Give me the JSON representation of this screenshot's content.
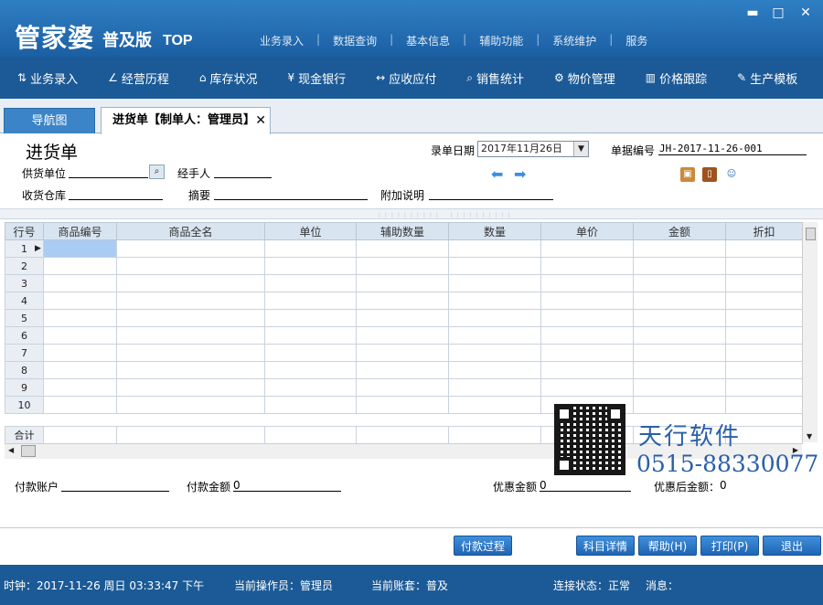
{
  "app": {
    "logo_main": "管家婆",
    "logo_edition": "普及版",
    "logo_top": "TOP"
  },
  "top_nav": [
    "业务录入",
    "数据查询",
    "基本信息",
    "辅助功能",
    "系统维护",
    "服务"
  ],
  "window_controls": {
    "minimize": "▬",
    "maximize": "□",
    "close": "✕"
  },
  "toolbar": [
    {
      "icon": "⇅",
      "label": "业务录入"
    },
    {
      "icon": "∠",
      "label": "经营历程"
    },
    {
      "icon": "⌂",
      "label": "库存状况"
    },
    {
      "icon": "¥",
      "label": "现金银行"
    },
    {
      "icon": "↔",
      "label": "应收应付"
    },
    {
      "icon": "⌕",
      "label": "销售统计"
    },
    {
      "icon": "⚙",
      "label": "物价管理"
    },
    {
      "icon": "▥",
      "label": "价格跟踪"
    },
    {
      "icon": "✎",
      "label": "生产模板"
    }
  ],
  "tabs": {
    "nav_label": "导航图",
    "doc_label": "进货单【制单人：管理员】",
    "close": "✕"
  },
  "form": {
    "title": "进货单",
    "supplier_label": "供货单位",
    "handler_label": "经手人",
    "warehouse_label": "收货仓库",
    "summary_label": "摘要",
    "extra_label": "附加说明",
    "date_label": "录单日期",
    "date_value": "2017年11月26日",
    "docno_label": "单据编号",
    "docno_value": "JH-2017-11-26-001"
  },
  "grid": {
    "columns": [
      "行号",
      "商品编号",
      "商品全名",
      "单位",
      "辅助数量",
      "数量",
      "单价",
      "金额",
      "折扣"
    ],
    "rows": [
      "1",
      "2",
      "3",
      "4",
      "5",
      "6",
      "7",
      "8",
      "9",
      "10"
    ],
    "total_label": "合计"
  },
  "watermark": {
    "company": "天行软件",
    "phone": "0515-88330077"
  },
  "footer": {
    "pay_account_label": "付款账户",
    "pay_amount_label": "付款金额",
    "pay_amount_value": "0",
    "discount_label": "优惠金额",
    "discount_value": "0",
    "after_discount_label": "优惠后金额：",
    "after_discount_value": "0"
  },
  "buttons": {
    "pay_process": "付款过程",
    "subject_detail": "科目详情",
    "help": "帮助(H)",
    "print": "打印(P)",
    "exit": "退出"
  },
  "status": {
    "clock": "时钟：2017-11-26 周日 03:33:47 下午",
    "operator": "当前操作员：管理员",
    "account": "当前账套：普及",
    "connection": "连接状态：正常",
    "message": "消息："
  }
}
